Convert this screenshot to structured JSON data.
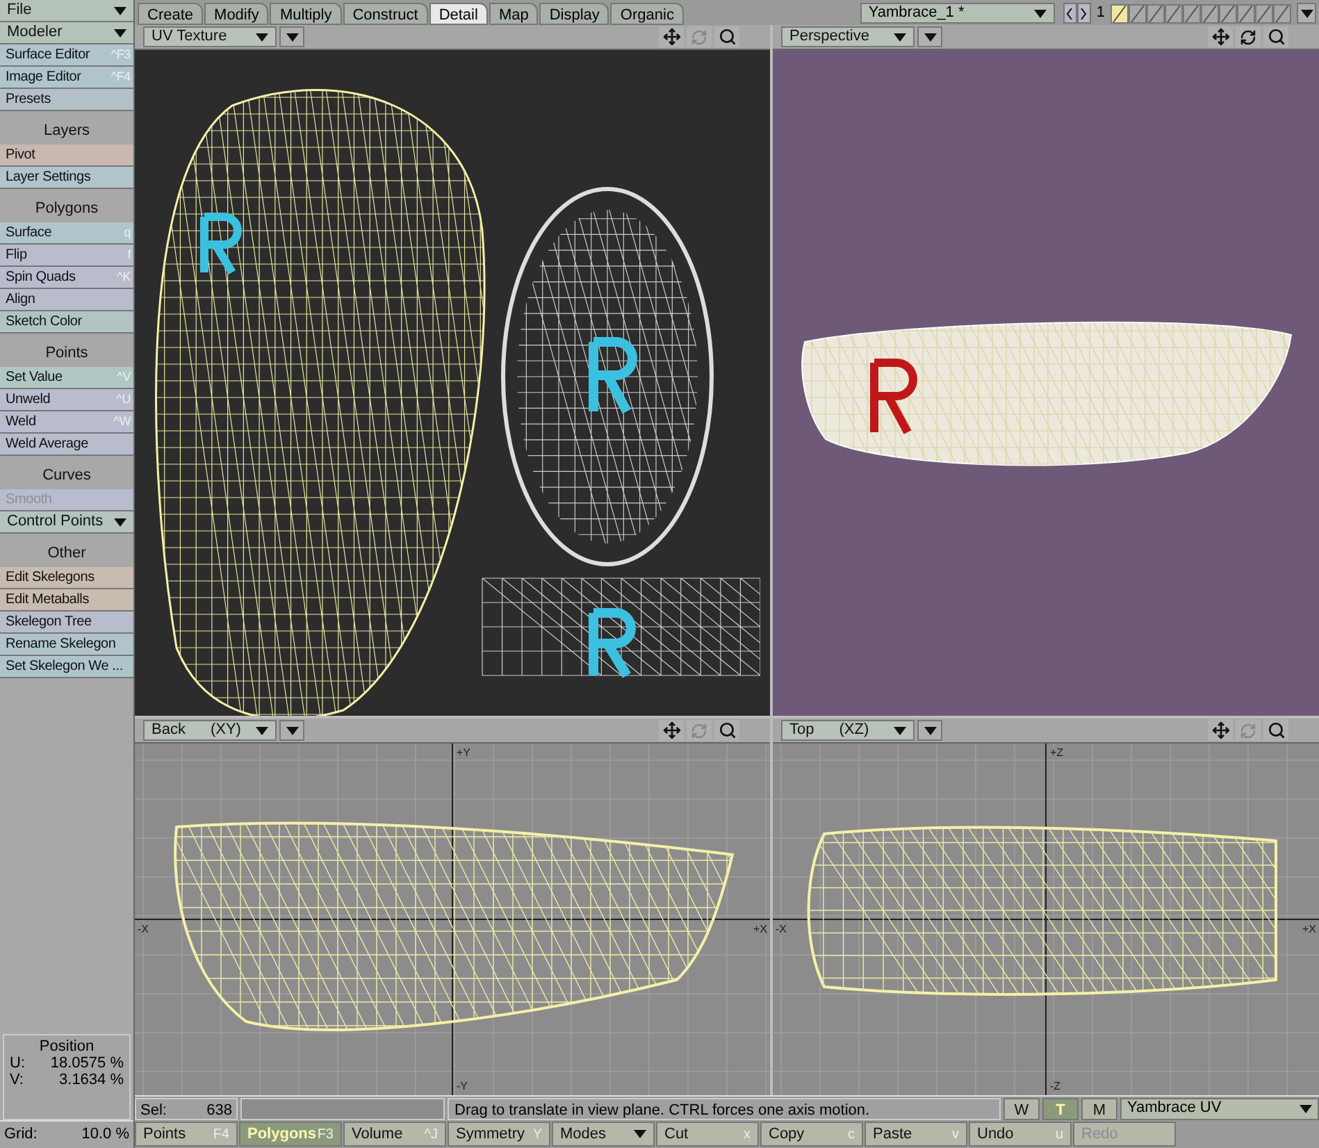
{
  "sidebar": {
    "items": [
      {
        "kind": "dropdown",
        "label": "File",
        "color": "#b4c2b8"
      },
      {
        "kind": "dropdown",
        "label": "Modeler",
        "color": "#b4c2b8"
      },
      {
        "kind": "button",
        "label": "Surface Editor",
        "shortcut": "^F3",
        "color": "#b0c4cc",
        "disabled": false
      },
      {
        "kind": "button",
        "label": "Image Editor",
        "shortcut": "^F4",
        "color": "#b0c4cc",
        "disabled": false
      },
      {
        "kind": "button",
        "label": "Presets",
        "color": "#b4c0c8",
        "disabled": false
      },
      {
        "kind": "header",
        "label": "Layers"
      },
      {
        "kind": "button",
        "label": "Pivot",
        "color": "#c8b8b0",
        "disabled": false
      },
      {
        "kind": "button",
        "label": "Layer Settings",
        "color": "#b0c4cc",
        "disabled": false
      },
      {
        "kind": "header",
        "label": "Polygons"
      },
      {
        "kind": "button",
        "label": "Surface",
        "shortcut": "q",
        "color": "#b0c4cc",
        "disabled": false
      },
      {
        "kind": "button",
        "label": "Flip",
        "shortcut": "f",
        "color": "#b8bccc",
        "disabled": false
      },
      {
        "kind": "button",
        "label": "Spin Quads",
        "shortcut": "^K",
        "color": "#b8bccc",
        "disabled": false
      },
      {
        "kind": "button",
        "label": "Align",
        "color": "#b8bccc",
        "disabled": false
      },
      {
        "kind": "button",
        "label": "Sketch Color",
        "color": "#b0c4c4",
        "disabled": false
      },
      {
        "kind": "header",
        "label": "Points"
      },
      {
        "kind": "button",
        "label": "Set Value",
        "shortcut": "^V",
        "color": "#b0c8c4",
        "disabled": false
      },
      {
        "kind": "button",
        "label": "Unweld",
        "shortcut": "^U",
        "color": "#b8bccc",
        "disabled": false
      },
      {
        "kind": "button",
        "label": "Weld",
        "shortcut": "^W",
        "color": "#b8bccc",
        "disabled": false
      },
      {
        "kind": "button",
        "label": "Weld Average",
        "color": "#b8bccc",
        "disabled": false
      },
      {
        "kind": "header",
        "label": "Curves"
      },
      {
        "kind": "button",
        "label": "Smooth",
        "color": "#b8bccc",
        "disabled": true
      },
      {
        "kind": "dropdown",
        "label": "Control Points",
        "color": "#b4c4bc"
      },
      {
        "kind": "header",
        "label": "Other"
      },
      {
        "kind": "button",
        "label": "Edit Skelegons",
        "color": "#c8bcb0",
        "disabled": false
      },
      {
        "kind": "button",
        "label": "Edit Metaballs",
        "color": "#c8bcb0",
        "disabled": false
      },
      {
        "kind": "button",
        "label": "Skelegon Tree",
        "color": "#b8bccc",
        "disabled": false
      },
      {
        "kind": "button",
        "label": "Rename Skelegon",
        "color": "#b0c4cc",
        "disabled": false
      },
      {
        "kind": "button",
        "label": "Set Skelegon We ...",
        "color": "#b0c4cc",
        "disabled": false
      }
    ]
  },
  "position": {
    "title": "Position",
    "rows": [
      {
        "axis": "U:",
        "value": "18.0575 %"
      },
      {
        "axis": "V:",
        "value": "3.1634 %"
      }
    ]
  },
  "grid": {
    "label": "Grid:",
    "value": "10.0 %"
  },
  "tabs": [
    {
      "label": "Create",
      "selected": false
    },
    {
      "label": "Modify",
      "selected": false
    },
    {
      "label": "Multiply",
      "selected": false
    },
    {
      "label": "Construct",
      "selected": false
    },
    {
      "label": "Detail",
      "selected": true
    },
    {
      "label": "Map",
      "selected": false
    },
    {
      "label": "Display",
      "selected": false
    },
    {
      "label": "Organic",
      "selected": false
    }
  ],
  "object": {
    "name": "Yambrace_1 *",
    "layer_number": "1",
    "layers": [
      {
        "selected": true
      },
      {
        "selected": false
      },
      {
        "selected": false
      },
      {
        "selected": false
      },
      {
        "selected": false
      },
      {
        "selected": false
      },
      {
        "selected": false
      },
      {
        "selected": false
      },
      {
        "selected": false
      },
      {
        "selected": false
      }
    ]
  },
  "viewports": [
    {
      "kind": "uv",
      "view": "UV Texture"
    },
    {
      "kind": "perspective",
      "view": "Perspective"
    },
    {
      "kind": "back",
      "view": "Back",
      "axis": "(XY)",
      "axis_labels": [
        "+Y",
        "-X",
        "+X",
        "-Y"
      ]
    },
    {
      "kind": "top",
      "view": "Top",
      "axis": "(XZ)",
      "axis_labels": [
        "+Z",
        "-X",
        "+X",
        "-Z"
      ]
    }
  ],
  "status": {
    "sel_label": "Sel:",
    "sel_value": "638",
    "message": "Drag to translate in view plane. CTRL forces one axis motion.",
    "modes": [
      {
        "label": "W",
        "selected": false
      },
      {
        "label": "T",
        "selected": true
      },
      {
        "label": "M",
        "selected": false
      }
    ],
    "uv_map": "Yambrace UV"
  },
  "toolbar": [
    {
      "kind": "button",
      "label": "Points",
      "shortcut": "F4",
      "selected": false,
      "disabled": false
    },
    {
      "kind": "button",
      "label": "Polygons",
      "shortcut": "F3",
      "selected": true,
      "disabled": false
    },
    {
      "kind": "button",
      "label": "Volume",
      "shortcut": "^J",
      "selected": false,
      "disabled": false
    },
    {
      "kind": "button",
      "label": "Symmetry",
      "shortcut": "Y",
      "selected": false,
      "disabled": false
    },
    {
      "kind": "dropdown",
      "label": "Modes",
      "selected": false,
      "disabled": false
    },
    {
      "kind": "button",
      "label": "Cut",
      "shortcut": "x",
      "selected": false,
      "disabled": false
    },
    {
      "kind": "button",
      "label": "Copy",
      "shortcut": "c",
      "selected": false,
      "disabled": false
    },
    {
      "kind": "button",
      "label": "Paste",
      "shortcut": "v",
      "selected": false,
      "disabled": false
    },
    {
      "kind": "button",
      "label": "Undo",
      "shortcut": "u",
      "selected": false,
      "disabled": false
    },
    {
      "kind": "button",
      "label": "Redo",
      "selected": false,
      "disabled": true
    }
  ]
}
